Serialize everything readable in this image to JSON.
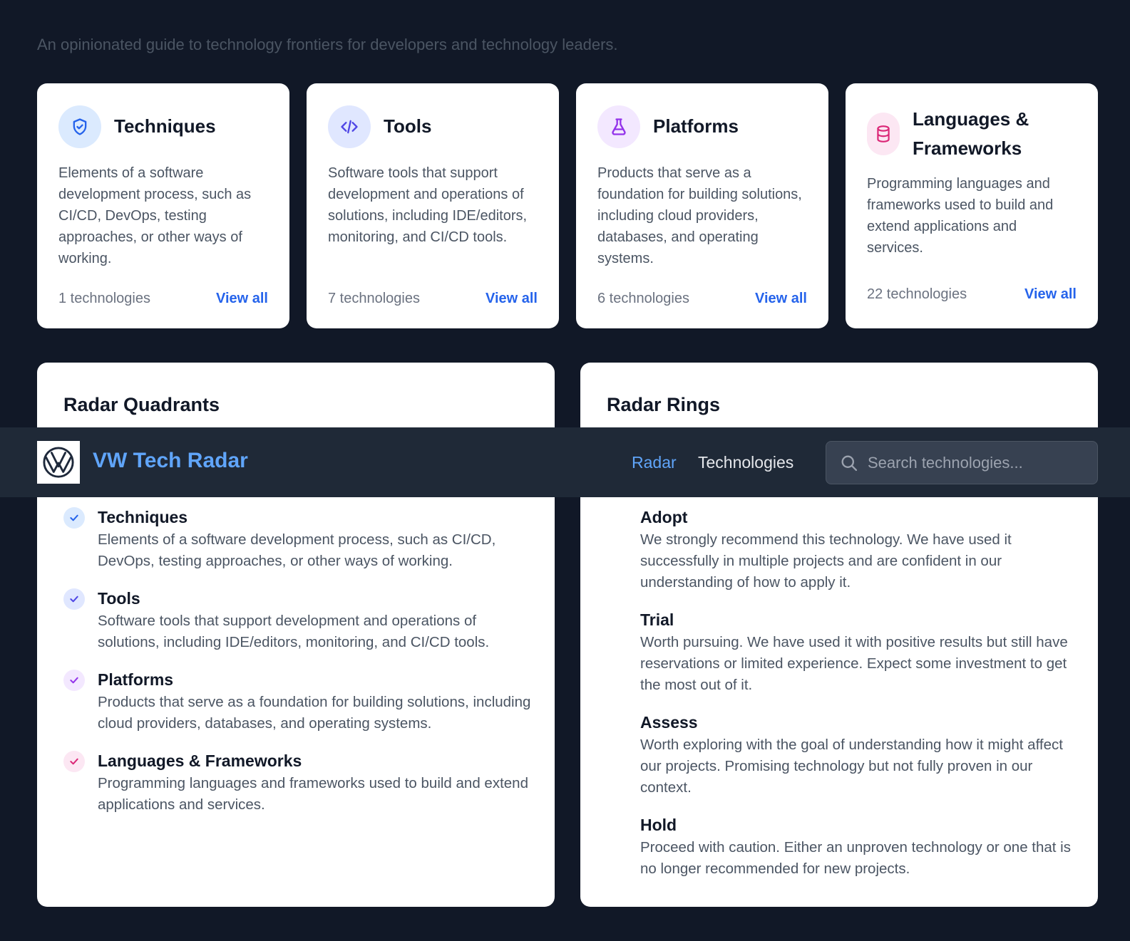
{
  "subtitle": "An opinionated guide to technology frontiers for developers and technology leaders.",
  "quadrant_cards": [
    {
      "title": "Techniques",
      "description": "Elements of a software development process, such as CI/CD, DevOps, testing approaches, or other ways of working.",
      "count": "1 technologies",
      "link": "View all",
      "icon": "shield-check-icon"
    },
    {
      "title": "Tools",
      "description": "Software tools that support development and operations of solutions, including IDE/editors, monitoring, and CI/CD tools.",
      "count": "7 technologies",
      "link": "View all",
      "icon": "code-icon"
    },
    {
      "title": "Platforms",
      "description": "Products that serve as a foundation for building solutions, including cloud providers, databases, and operating systems.",
      "count": "6 technologies",
      "link": "View all",
      "icon": "flask-icon"
    },
    {
      "title": "Languages & Frameworks",
      "description": "Programming languages and frameworks used to build and extend applications and services.",
      "count": "22 technologies",
      "link": "View all",
      "icon": "database-icon"
    }
  ],
  "radar_quadrants": {
    "title": "Radar Quadrants",
    "items": [
      {
        "name": "Techniques",
        "description": "Elements of a software development process, such as CI/CD, DevOps, testing approaches, or other ways of working."
      },
      {
        "name": "Tools",
        "description": "Software tools that support development and operations of solutions, including IDE/editors, monitoring, and CI/CD tools."
      },
      {
        "name": "Platforms",
        "description": "Products that serve as a foundation for building solutions, including cloud providers, databases, and operating systems."
      },
      {
        "name": "Languages & Frameworks",
        "description": "Programming languages and frameworks used to build and extend applications and services."
      }
    ]
  },
  "radar_rings": {
    "title": "Radar Rings",
    "items": [
      {
        "name": "Adopt",
        "description": "We strongly recommend this technology. We have used it successfully in multiple projects and are confident in our understanding of how to apply it."
      },
      {
        "name": "Trial",
        "description": "Worth pursuing. We have used it with positive results but still have reservations or limited experience. Expect some investment to get the most out of it."
      },
      {
        "name": "Assess",
        "description": "Worth exploring with the goal of understanding how it might affect our projects. Promising technology but not fully proven in our context."
      },
      {
        "name": "Hold",
        "description": "Proceed with caution. Either an unproven technology or one that is no longer recommended for new projects."
      }
    ]
  },
  "navbar": {
    "brand": "VW Tech Radar",
    "links": [
      "Radar",
      "Technologies"
    ],
    "active_link": "Radar",
    "search_placeholder": "Search technologies...",
    "search_value": ""
  },
  "colors": {
    "background": "#111827",
    "navbar": "#1f2937",
    "accent_blue": "#2563eb",
    "techniques": "#2563eb",
    "tools": "#4f46e5",
    "platforms": "#9333ea",
    "languages": "#db2777"
  }
}
